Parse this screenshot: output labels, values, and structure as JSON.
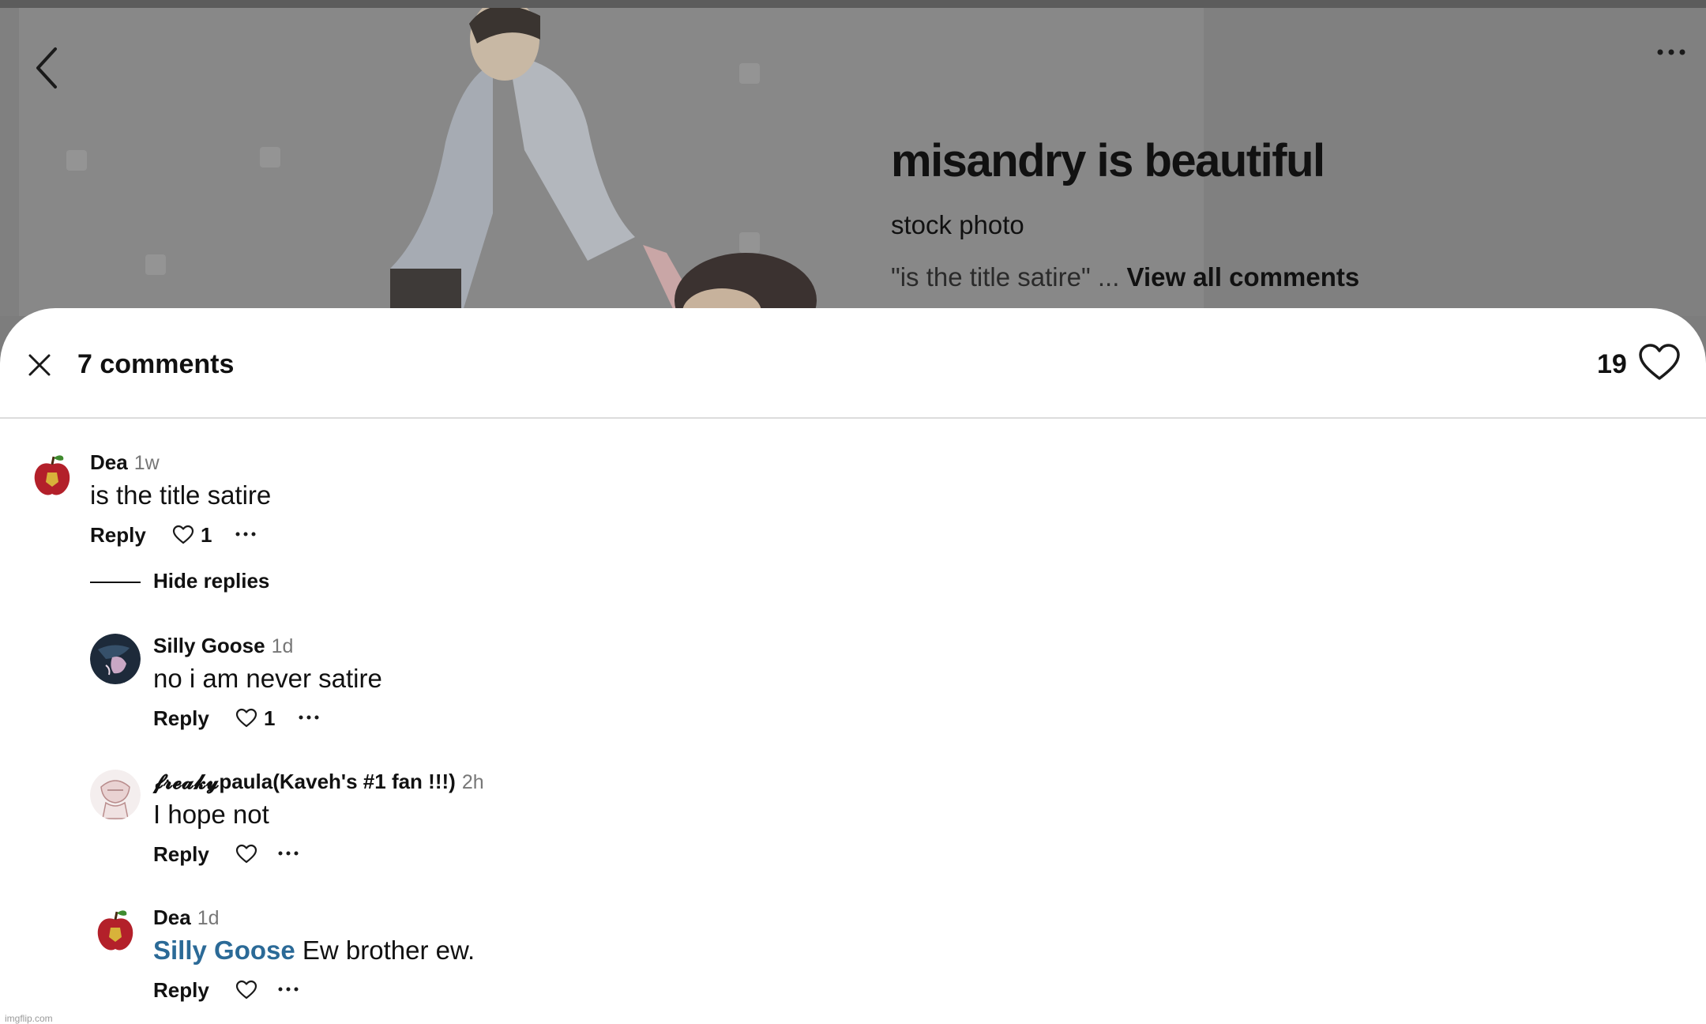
{
  "post": {
    "title": "misandry is beautiful",
    "subtitle": "stock photo",
    "preview_text": "\"is the title satire\" ...",
    "view_all_label": "View all comments"
  },
  "comments_sheet": {
    "count_label": "7 comments",
    "like_count": "19",
    "hide_replies_label": "Hide replies",
    "comments": [
      {
        "author": "Dea",
        "time": "1w",
        "text": "is the title satire",
        "reply_label": "Reply",
        "likes": "1"
      },
      {
        "author": "Silly Goose",
        "time": "1d",
        "text": "no i am never satire",
        "reply_label": "Reply",
        "likes": "1"
      },
      {
        "author": "𝓯𝓻𝓮𝓪𝓴𝔂paula(Kaveh's #1 fan !!!)",
        "time": "2h",
        "text": "I hope not",
        "reply_label": "Reply",
        "likes": ""
      },
      {
        "author": "Dea",
        "time": "1d",
        "mention": "Silly Goose",
        "text": "Ew brother ew.",
        "reply_label": "Reply",
        "likes": ""
      }
    ]
  },
  "footer": {
    "watermark": "imgflip.com"
  },
  "icons": {
    "back": "chevron-left-icon",
    "more": "more-horizontal-icon",
    "close": "close-icon",
    "like": "heart-icon"
  },
  "colors": {
    "mention": "#2b6a97",
    "overlay": "#808080",
    "sheet": "#ffffff"
  }
}
